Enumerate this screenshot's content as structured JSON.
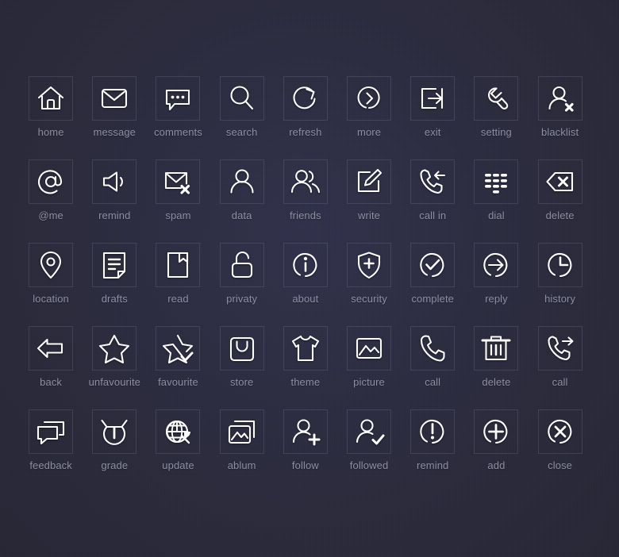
{
  "sheet": {
    "title": "icon set",
    "background_color": "#2b2b3d",
    "icon_color": "#fdfdff",
    "label_color": "#8d8fa2",
    "box_border_color": "rgba(170,175,200,0.17)",
    "columns": 9,
    "rows": 5,
    "total_icons": 45
  },
  "rows": [
    {
      "index": 0,
      "icons": [
        {
          "icon": "home-icon",
          "label": "home"
        },
        {
          "icon": "message-icon",
          "label": "message"
        },
        {
          "icon": "comments-icon",
          "label": "comments"
        },
        {
          "icon": "search-icon",
          "label": "search"
        },
        {
          "icon": "refresh-icon",
          "label": "refresh"
        },
        {
          "icon": "more-icon",
          "label": "more"
        },
        {
          "icon": "exit-icon",
          "label": "exit"
        },
        {
          "icon": "setting-icon",
          "label": "setting"
        },
        {
          "icon": "blacklist-icon",
          "label": "blacklist"
        }
      ]
    },
    {
      "index": 1,
      "icons": [
        {
          "icon": "at-me-icon",
          "label": "@me"
        },
        {
          "icon": "remind-speaker-icon",
          "label": "remind"
        },
        {
          "icon": "spam-icon",
          "label": "spam"
        },
        {
          "icon": "data-user-icon",
          "label": "data"
        },
        {
          "icon": "friends-icon",
          "label": "friends"
        },
        {
          "icon": "write-icon",
          "label": "write"
        },
        {
          "icon": "call-in-icon",
          "label": "call in"
        },
        {
          "icon": "dial-icon",
          "label": "dial"
        },
        {
          "icon": "delete-backspace-icon",
          "label": "delete"
        }
      ]
    },
    {
      "index": 2,
      "icons": [
        {
          "icon": "location-icon",
          "label": "location"
        },
        {
          "icon": "drafts-icon",
          "label": "drafts"
        },
        {
          "icon": "read-book-icon",
          "label": "read"
        },
        {
          "icon": "privacy-lock-icon",
          "label": "privaty"
        },
        {
          "icon": "about-info-icon",
          "label": "about"
        },
        {
          "icon": "security-shield-icon",
          "label": "security"
        },
        {
          "icon": "complete-check-icon",
          "label": "complete"
        },
        {
          "icon": "reply-arrow-icon",
          "label": "reply"
        },
        {
          "icon": "history-clock-icon",
          "label": "history"
        }
      ]
    },
    {
      "index": 3,
      "icons": [
        {
          "icon": "back-arrow-icon",
          "label": "back"
        },
        {
          "icon": "unfavourite-star-icon",
          "label": "unfavourite"
        },
        {
          "icon": "favourite-star-check-icon",
          "label": "favourite"
        },
        {
          "icon": "store-bag-icon",
          "label": "store"
        },
        {
          "icon": "theme-shirt-icon",
          "label": "theme"
        },
        {
          "icon": "picture-icon",
          "label": "picture"
        },
        {
          "icon": "call-icon",
          "label": "call"
        },
        {
          "icon": "delete-trash-icon",
          "label": "delete"
        },
        {
          "icon": "call-out-icon",
          "label": "call"
        }
      ]
    },
    {
      "index": 4,
      "icons": [
        {
          "icon": "feedback-icon",
          "label": "feedback"
        },
        {
          "icon": "grade-icon",
          "label": "grade"
        },
        {
          "icon": "update-globe-icon",
          "label": "update"
        },
        {
          "icon": "album-icon",
          "label": "ablum"
        },
        {
          "icon": "follow-user-add-icon",
          "label": "follow"
        },
        {
          "icon": "followed-user-check-icon",
          "label": "followed"
        },
        {
          "icon": "remind-exclaim-icon",
          "label": "remind"
        },
        {
          "icon": "add-plus-icon",
          "label": "add"
        },
        {
          "icon": "close-x-icon",
          "label": "close"
        }
      ]
    }
  ]
}
